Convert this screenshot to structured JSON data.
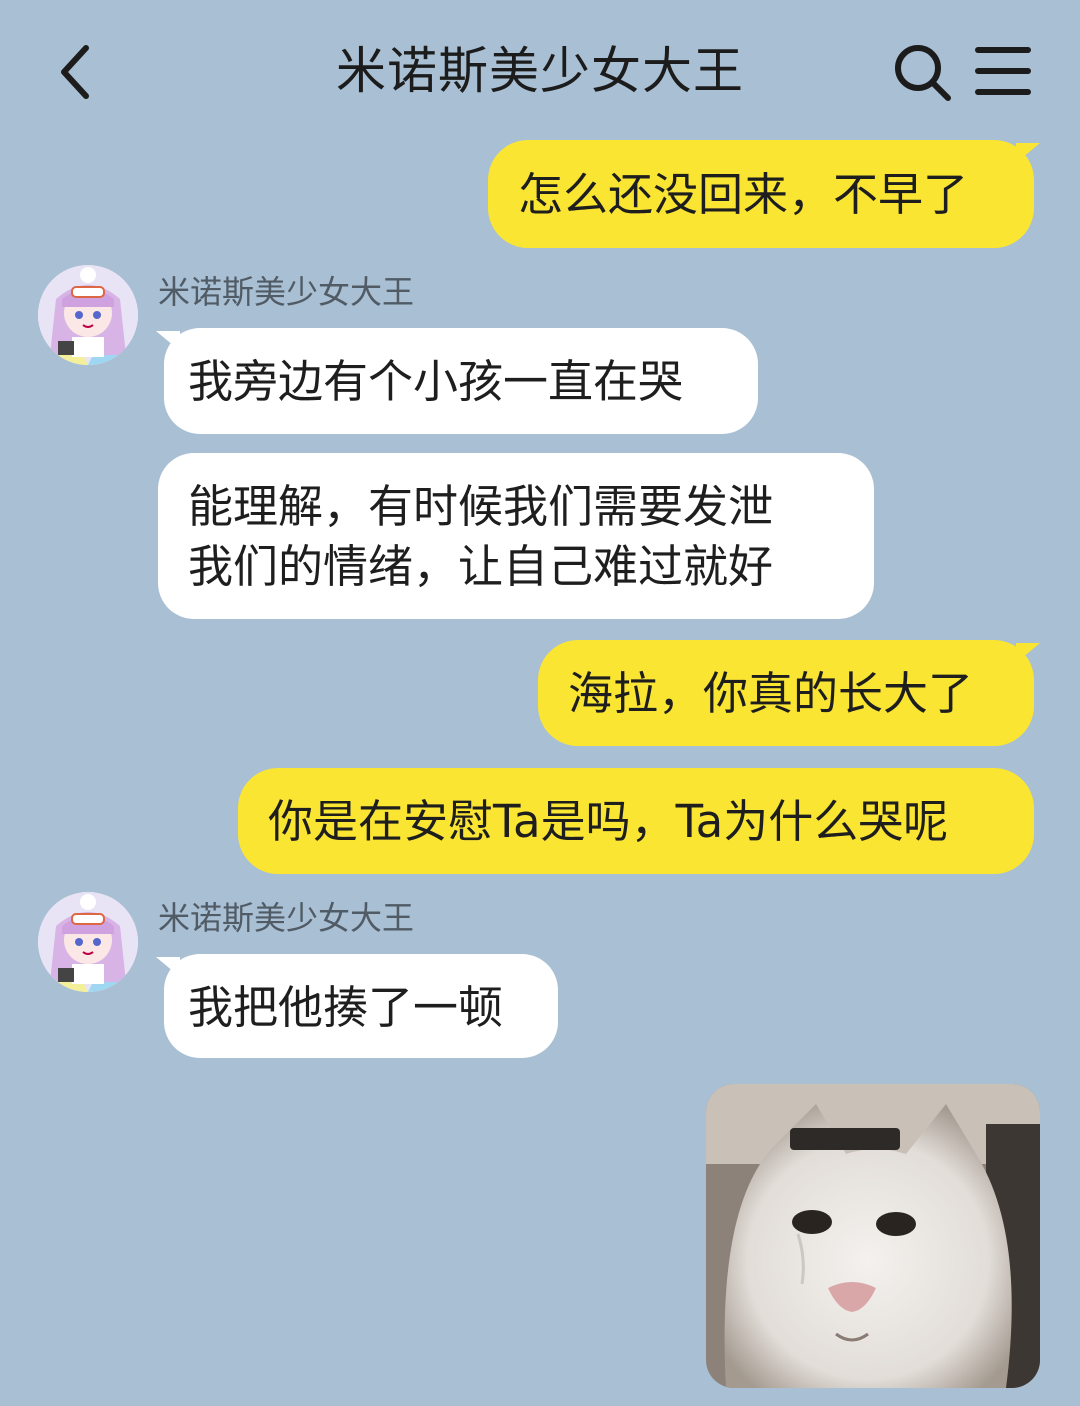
{
  "header": {
    "title": "米诺斯美少女大王",
    "back_icon": "chevron-left-icon",
    "search_icon": "search-icon",
    "menu_icon": "hamburger-menu-icon"
  },
  "messages": [
    {
      "side": "me",
      "text": "怎么还没回来，不早了"
    },
    {
      "side": "other",
      "sender": "米诺斯美少女大王",
      "text": "我旁边有个小孩一直在哭"
    },
    {
      "side": "other",
      "text_lines": [
        "能理解，有时候我们需要发泄",
        "我们的情绪，让自己难过就好"
      ]
    },
    {
      "side": "me",
      "text": "海拉，你真的长大了"
    },
    {
      "side": "me",
      "text": "你是在安慰Ta是吗，Ta为什么哭呢"
    },
    {
      "side": "other",
      "sender": "米诺斯美少女大王",
      "text": "我把他揍了一顿"
    },
    {
      "side": "me",
      "type": "sticker",
      "sticker": "crying-white-cat-sticker"
    }
  ],
  "colors": {
    "background": "#a9bfd3",
    "my_bubble": "#fae533",
    "their_bubble": "#ffffff"
  }
}
